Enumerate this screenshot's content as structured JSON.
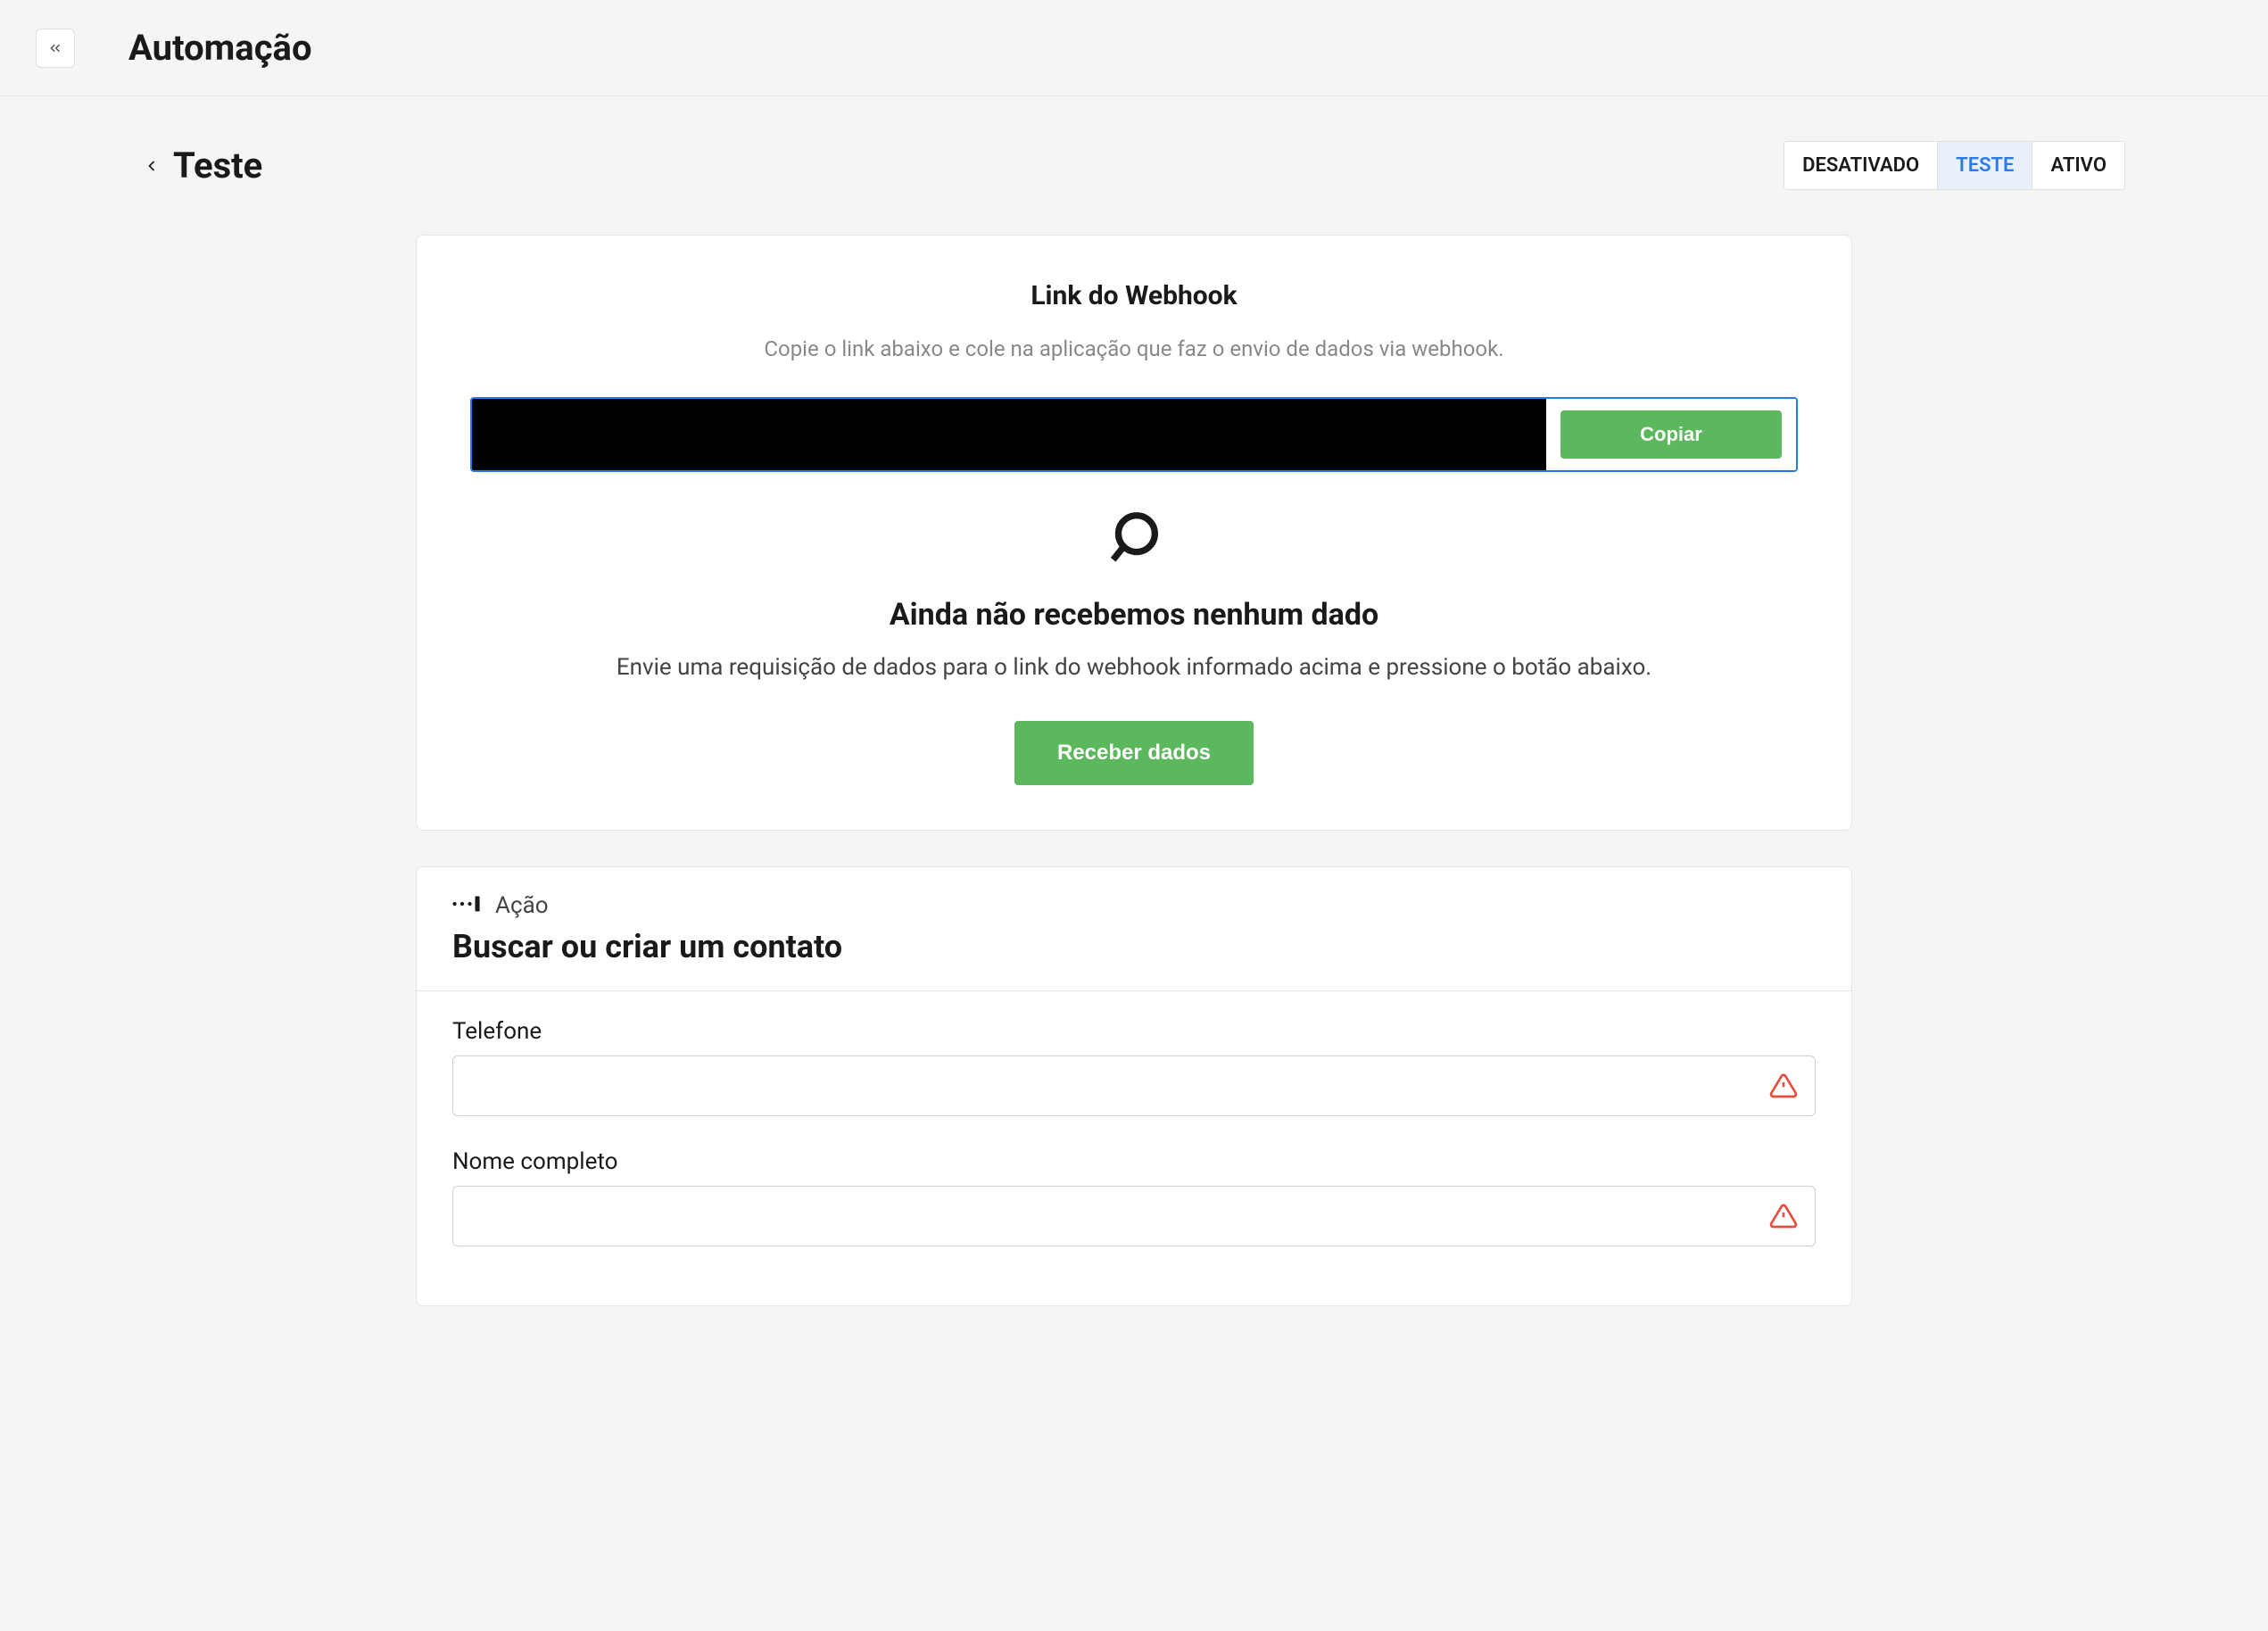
{
  "header": {
    "title": "Automação"
  },
  "page": {
    "title": "Teste"
  },
  "status_tabs": {
    "desativado": "DESATIVADO",
    "teste": "TESTE",
    "ativo": "ATIVO"
  },
  "webhook": {
    "title": "Link do Webhook",
    "subtitle": "Copie o link abaixo e cole na aplicação que faz o envio de dados via webhook.",
    "url": "",
    "copy_label": "Copiar"
  },
  "empty_state": {
    "title": "Ainda não recebemos nenhum dado",
    "description": "Envie uma requisição de dados para o link do webhook informado acima e pressione o botão abaixo.",
    "button_label": "Receber dados"
  },
  "action": {
    "section_label": "Ação",
    "title": "Buscar ou criar um contato",
    "fields": {
      "telefone": {
        "label": "Telefone",
        "value": ""
      },
      "nome": {
        "label": "Nome completo",
        "value": ""
      }
    }
  }
}
